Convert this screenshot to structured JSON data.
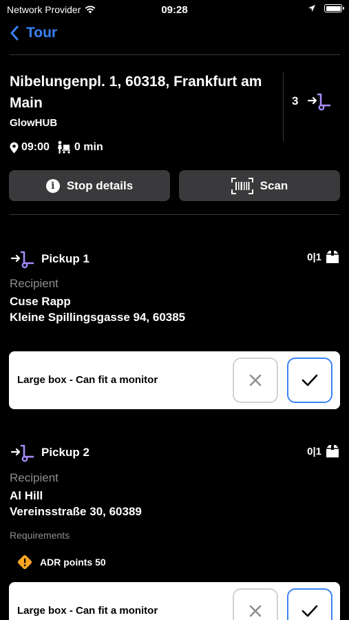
{
  "status_bar": {
    "carrier": "Network Provider",
    "time": "09:28"
  },
  "nav": {
    "back_label": "Tour"
  },
  "stop": {
    "address": "Nibelungenpl. 1, 60318, Frankfurt am Main",
    "hub": "GlowHUB",
    "time": "09:00",
    "duration": "0 min",
    "count": "3"
  },
  "actions": {
    "details_label": "Stop details",
    "scan_label": "Scan"
  },
  "pickups": [
    {
      "title": "Pickup 1",
      "count": "0|1",
      "recipient_label": "Recipient",
      "recipient_name": "Cuse Rapp",
      "recipient_address": "Kleine Spillingsgasse 94, 60385",
      "item_label": "Large box - Can fit a monitor"
    },
    {
      "title": "Pickup 2",
      "count": "0|1",
      "recipient_label": "Recipient",
      "recipient_name": "Al Hill",
      "recipient_address": "Vereinsstraße 30, 60389",
      "requirements_label": "Requirements",
      "requirement": "ADR points 50",
      "item_label": "Large box - Can fit a monitor"
    }
  ],
  "colors": {
    "accent": "#3b82f6",
    "pickup_icon": "#a78bfa",
    "warning": "#f5a524",
    "button_bg": "#3a3a3c"
  }
}
